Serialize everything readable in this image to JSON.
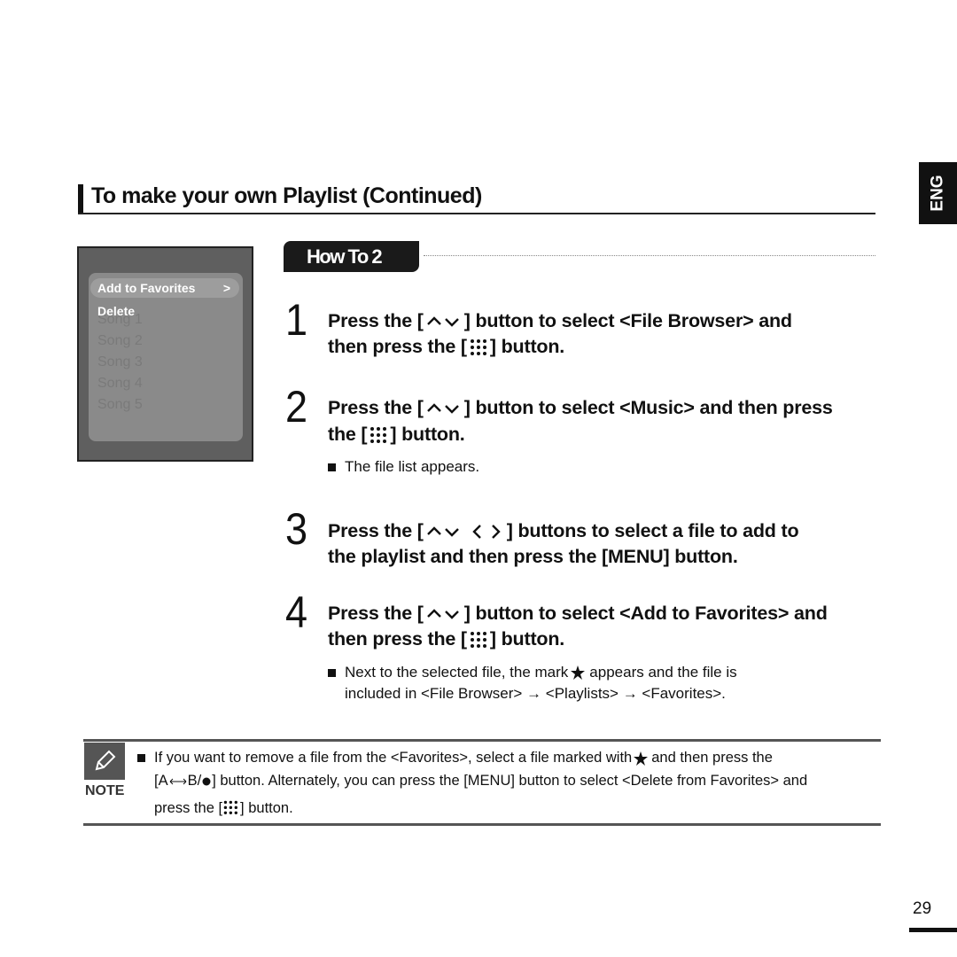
{
  "header": {
    "title": "To make your own Playlist  (Continued)",
    "lang_tab": "ENG"
  },
  "device_screen": {
    "menu": [
      "Add to Favorites",
      "Delete"
    ],
    "menu_arrow": ">",
    "songs": [
      "Song 1",
      "Song 2",
      "Song 3",
      "Song 4",
      "Song 5"
    ]
  },
  "howto": {
    "label": "How To 2"
  },
  "steps": [
    {
      "num": "1",
      "l1a": "Press the [",
      "l1b": "] button to select <File Browser> and",
      "l2a": "then press the [",
      "l2b": "] button."
    },
    {
      "num": "2",
      "l1a": "Press the [",
      "l1b": "] button to select <Music> and then press",
      "l2a": "the [",
      "l2b": "] button.",
      "note": "The file list appears."
    },
    {
      "num": "3",
      "l1a": "Press the [",
      "l1b": "] buttons to select a file to add to",
      "l2": "the playlist and then press the [MENU] button."
    },
    {
      "num": "4",
      "l1a": "Press the [",
      "l1b": "] button to select <Add to Favorites> and",
      "l2a": "then press the [",
      "l2b": "] button.",
      "note_a": "Next to the selected file, the mark",
      "note_b": "appears and the file is",
      "note_c": "included in <File Browser> → <Playlists> → <Favorites>."
    }
  ],
  "note": {
    "label": "NOTE",
    "l1a": "If you want to remove a file from the <Favorites>, select a file marked with",
    "l1b": "and then press the",
    "l2a": "[A",
    "l2b": "B/",
    "l2c": "] button. Alternately, you can press the [MENU] button to select <Delete from Favorites> and",
    "l3a": "press the [",
    "l3b": "] button."
  },
  "page_number": "29"
}
